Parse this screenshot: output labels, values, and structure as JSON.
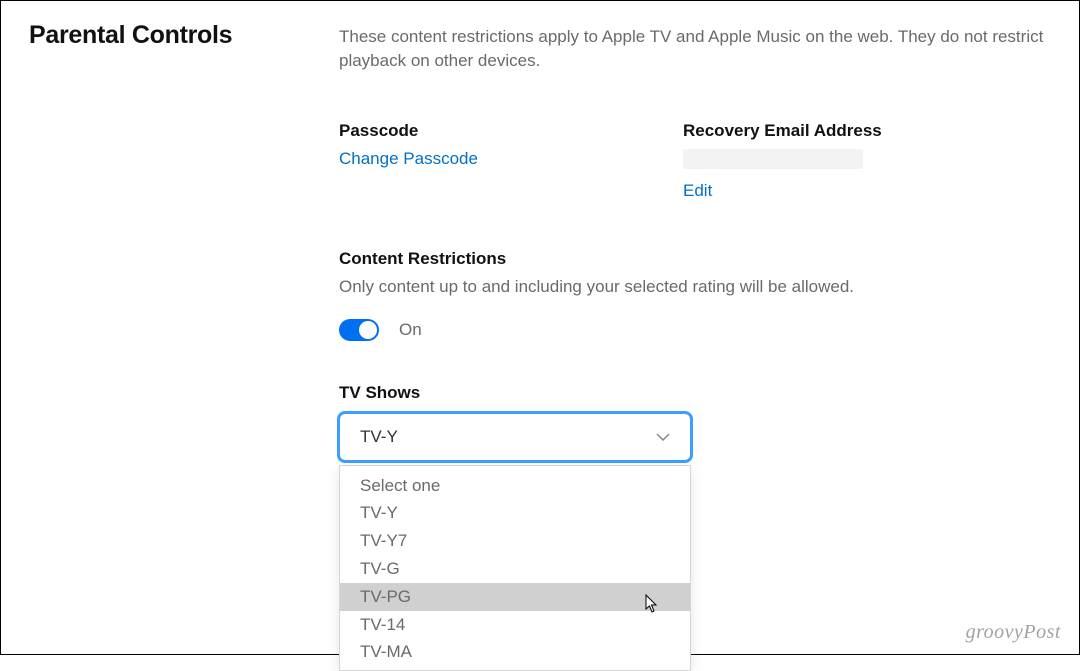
{
  "page": {
    "title": "Parental Controls",
    "description": "These content restrictions apply to Apple TV and Apple Music on the web. They do not restrict playback on other devices."
  },
  "passcode": {
    "heading": "Passcode",
    "change_link": "Change Passcode"
  },
  "recovery": {
    "heading": "Recovery Email Address",
    "edit_link": "Edit"
  },
  "restrictions": {
    "heading": "Content Restrictions",
    "subtext": "Only content up to and including your selected rating will be allowed.",
    "toggle_state": "On"
  },
  "tvshows": {
    "label": "TV Shows",
    "selected": "TV-Y",
    "options": {
      "placeholder": "Select one",
      "o1": "TV-Y",
      "o2": "TV-Y7",
      "o3": "TV-G",
      "o4": "TV-PG",
      "o5": "TV-14",
      "o6": "TV-MA"
    }
  },
  "watermark": "groovyPost"
}
